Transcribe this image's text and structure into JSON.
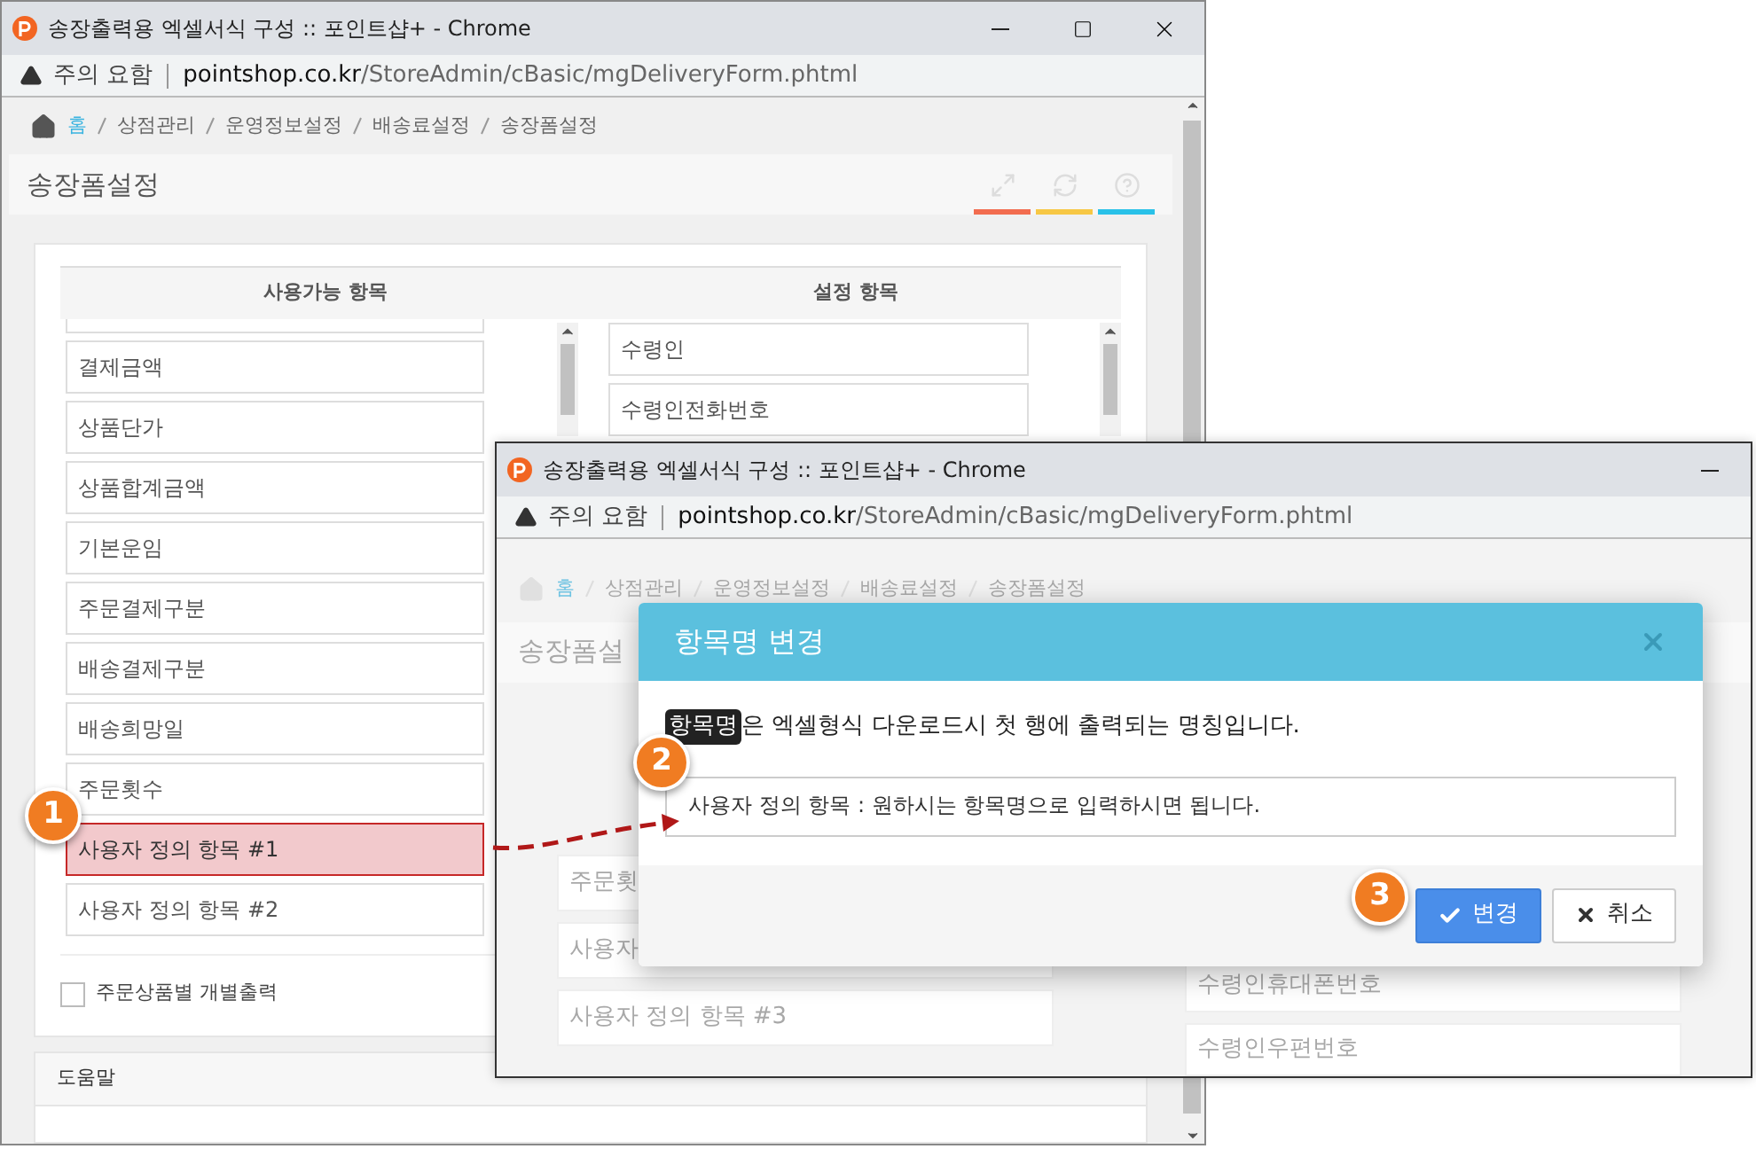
{
  "background_window": {
    "title": "송장출력용 엑셀서식 구성 :: 포인트샵+ - Chrome",
    "address_warning": "주의 요함",
    "url_host": "pointshop.co.kr",
    "url_path": "/StoreAdmin/cBasic/mgDeliveryForm.phtml",
    "breadcrumb": [
      "홈",
      "상점관리",
      "운영정보설정",
      "배송료설정",
      "송장폼설정"
    ],
    "page_title": "송장폼설정",
    "columns": [
      "사용가능 항목",
      "설정 항목"
    ],
    "available_items": [
      {
        "label": "결제금액",
        "selected": false
      },
      {
        "label": "상품단가",
        "selected": false
      },
      {
        "label": "상품합계금액",
        "selected": false
      },
      {
        "label": "기본운임",
        "selected": false
      },
      {
        "label": "주문결제구분",
        "selected": false
      },
      {
        "label": "배송결제구분",
        "selected": false
      },
      {
        "label": "배송희망일",
        "selected": false
      },
      {
        "label": "주문횟수",
        "selected": false
      },
      {
        "label": "사용자 정의 항목 #1",
        "selected": true
      },
      {
        "label": "사용자 정의 항목 #2",
        "selected": false
      }
    ],
    "configured_items": [
      "수령인",
      "수령인전화번호"
    ],
    "option": {
      "label": "주문상품별 개별출력",
      "checked": false
    },
    "help_title": "도움말"
  },
  "foreground_window": {
    "title": "송장출력용 엑셀서식 구성 :: 포인트샵+ - Chrome",
    "address_warning": "주의 요함",
    "url_host": "pointshop.co.kr",
    "url_path": "/StoreAdmin/cBasic/mgDeliveryForm.phtml",
    "breadcrumb": [
      "홈",
      "상점관리",
      "운영정보설정",
      "배송료설정",
      "송장폼설정"
    ],
    "page_title": "송장폼설",
    "available_items": [
      "주문횟",
      "사용자",
      "사용자 정의 항목 #3"
    ],
    "configured_items": [
      "수령인휴대폰번호",
      "수령인우편번호"
    ],
    "dialog": {
      "title": "항목명 변경",
      "term": "항목명",
      "description": "은 엑셀형식 다운로드시 첫 행에 출력되는 명칭입니다.",
      "input_value": "사용자 정의 항목 : 원하시는 항목명으로 입력하시면 됩니다.",
      "buttons": [
        {
          "kind": "primary",
          "label": "변경"
        },
        {
          "kind": "cancel",
          "label": "취소"
        }
      ]
    }
  },
  "markers": [
    "1",
    "2",
    "3"
  ]
}
